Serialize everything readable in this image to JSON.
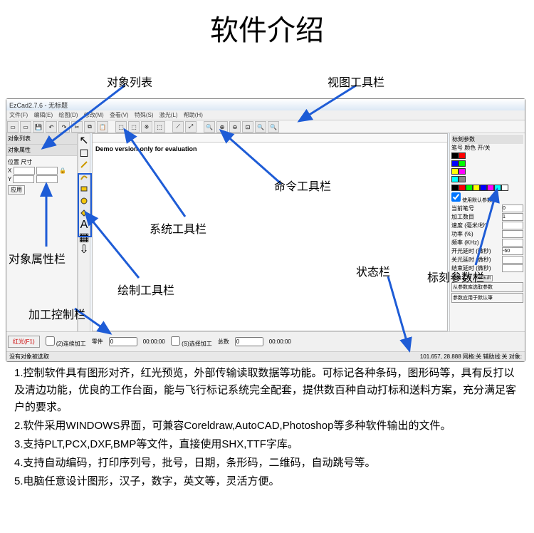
{
  "page_title": "软件介绍",
  "labels": {
    "object_list": "对象列表",
    "view_toolbar": "视图工具栏",
    "command_toolbar": "命令工具栏",
    "status_bar": "状态栏",
    "mark_params": "标刻参数栏",
    "system_toolbar": "系统工具栏",
    "draw_toolbar": "绘制工具栏",
    "object_props": "对象属性栏",
    "process_control": "加工控制栏"
  },
  "app": {
    "title": "EzCad2.7.6 - 无标题",
    "menu": [
      "文件(F)",
      "编辑(E)",
      "绘图(D)",
      "修改(M)",
      "查看(V)",
      "特殊(S)",
      "激光(L)",
      "帮助(H)"
    ],
    "left_tabs": {
      "list_tab": "对象列表",
      "prop_tab": "对象属性"
    },
    "props": {
      "pos_label": "位置",
      "size_label": "尺寸",
      "x": "X",
      "y": "Y"
    },
    "canvas_text": "Demo version-only for evaluation",
    "right": {
      "title": "标刻参数",
      "pen_header": "笔号  颜色  开/关",
      "use_default": "使用默认参数",
      "current_pen": "当前笔号",
      "current_pen_val": "0",
      "count": "加工数目",
      "count_val": "1",
      "speed": "速度 (毫米/秒)",
      "speed_val": "",
      "power": "功率 (%)",
      "freq": "频率 (KHz)",
      "open_delay": "开光延时 (微秒)",
      "open_delay_val": "-60",
      "close_delay": "关光延时 (微秒)",
      "end_delay": "结束延时 (微秒)",
      "param_name": "参数名称",
      "default": "Default",
      "select_param": "从参数库选取参数",
      "apply": "参数应用于默认筆"
    },
    "bottom": {
      "red": "红光(F1)",
      "continuous": "(2)连续加工",
      "part": "零件",
      "select_mark": "(S)选择加工",
      "total": "总数",
      "part_val": "0",
      "total_val": "0",
      "time1": "00:00:00",
      "time2": "00:00:00"
    },
    "status": {
      "left": "没有对象被选取",
      "right": "101.657, 28.888    网格:关  辅助线:关  对象:"
    }
  },
  "desc": {
    "p1": "1.控制软件具有图形对齐，红光预览，外部传输读取数据等功能。可标记各种条码，图形码等，具有反打以及清边功能，优良的工作台面，能与飞行标记系统完全配套，提供数百种自动打标和送料方案，充分满足客户的要求。",
    "p2": "2.软件采用WINDOWS界面，可兼容Coreldraw,AutoCAD,Photoshop等多种软件输出的文件。",
    "p3": "3.支持PLT,PCX,DXF,BMP等文件，直接使用SHX,TTF字库。",
    "p4": "4.支持自动编码，打印序列号，批号，日期，条形码，二维码，自动跳号等。",
    "p5": "5.电脑任意设计图形，汉子，数字，英文等，灵活方便。"
  }
}
